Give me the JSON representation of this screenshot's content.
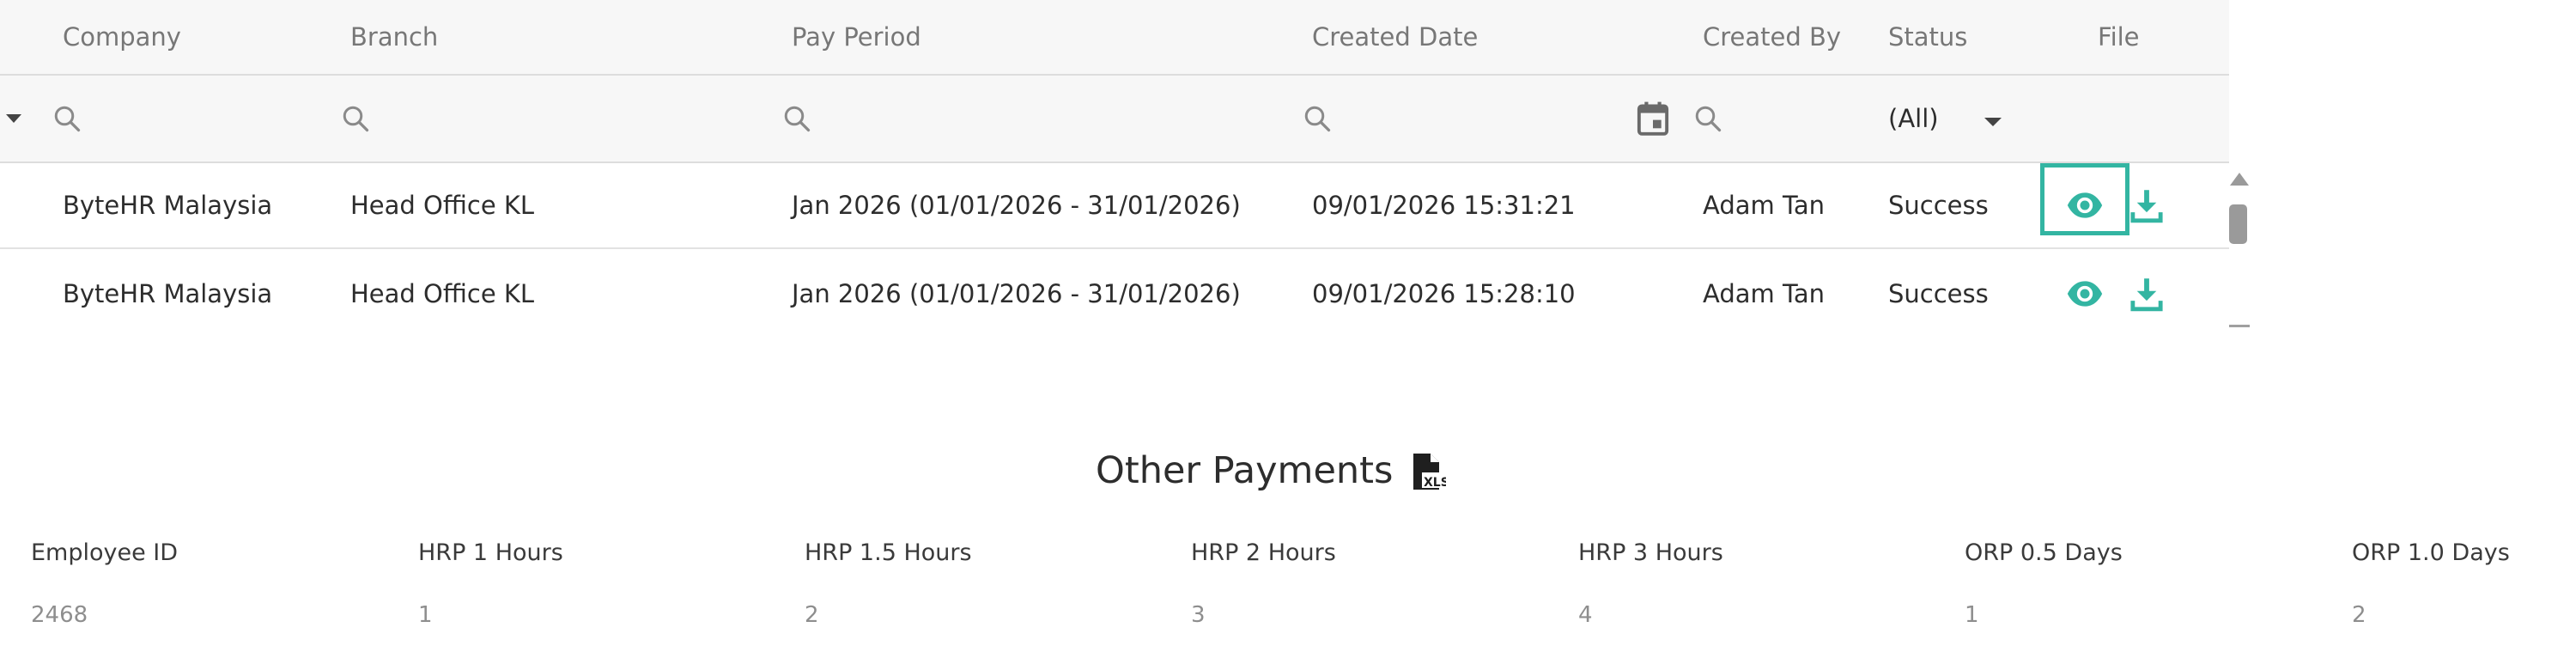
{
  "grid": {
    "columns": {
      "company": "Company",
      "branch": "Branch",
      "pay_period": "Pay Period",
      "created_date": "Created Date",
      "created_by": "Created By",
      "status": "Status",
      "file": "File"
    },
    "filters": {
      "status_selected": "(All)"
    },
    "rows": [
      {
        "company": "ByteHR Malaysia",
        "branch": "Head Office KL",
        "pay_period": "Jan 2026 (01/01/2026 - 31/01/2026)",
        "created_date": "09/01/2026 15:31:21",
        "created_by": "Adam Tan",
        "status": "Success"
      },
      {
        "company": "ByteHR Malaysia",
        "branch": "Head Office KL",
        "pay_period": "Jan 2026 (01/01/2026 - 31/01/2026)",
        "created_date": "09/01/2026 15:28:10",
        "created_by": "Adam Tan",
        "status": "Success"
      }
    ],
    "icons": {
      "search": "search-icon",
      "calendar": "calendar-icon",
      "view": "eye-icon",
      "download": "download-icon",
      "dropdown": "caret-down-icon",
      "export": "xls-file-icon"
    },
    "colors": {
      "accent": "#33b5a2",
      "header_bg": "#f7f7f7"
    }
  },
  "other_payments": {
    "title": "Other Payments",
    "xls_label": "XLS",
    "headers": [
      "Employee ID",
      "HRP 1 Hours",
      "HRP 1.5 Hours",
      "HRP 2 Hours",
      "HRP 3 Hours",
      "ORP 0.5 Days",
      "ORP 1.0 Days"
    ],
    "values": [
      "2468",
      "1",
      "2",
      "3",
      "4",
      "1",
      "2"
    ]
  }
}
